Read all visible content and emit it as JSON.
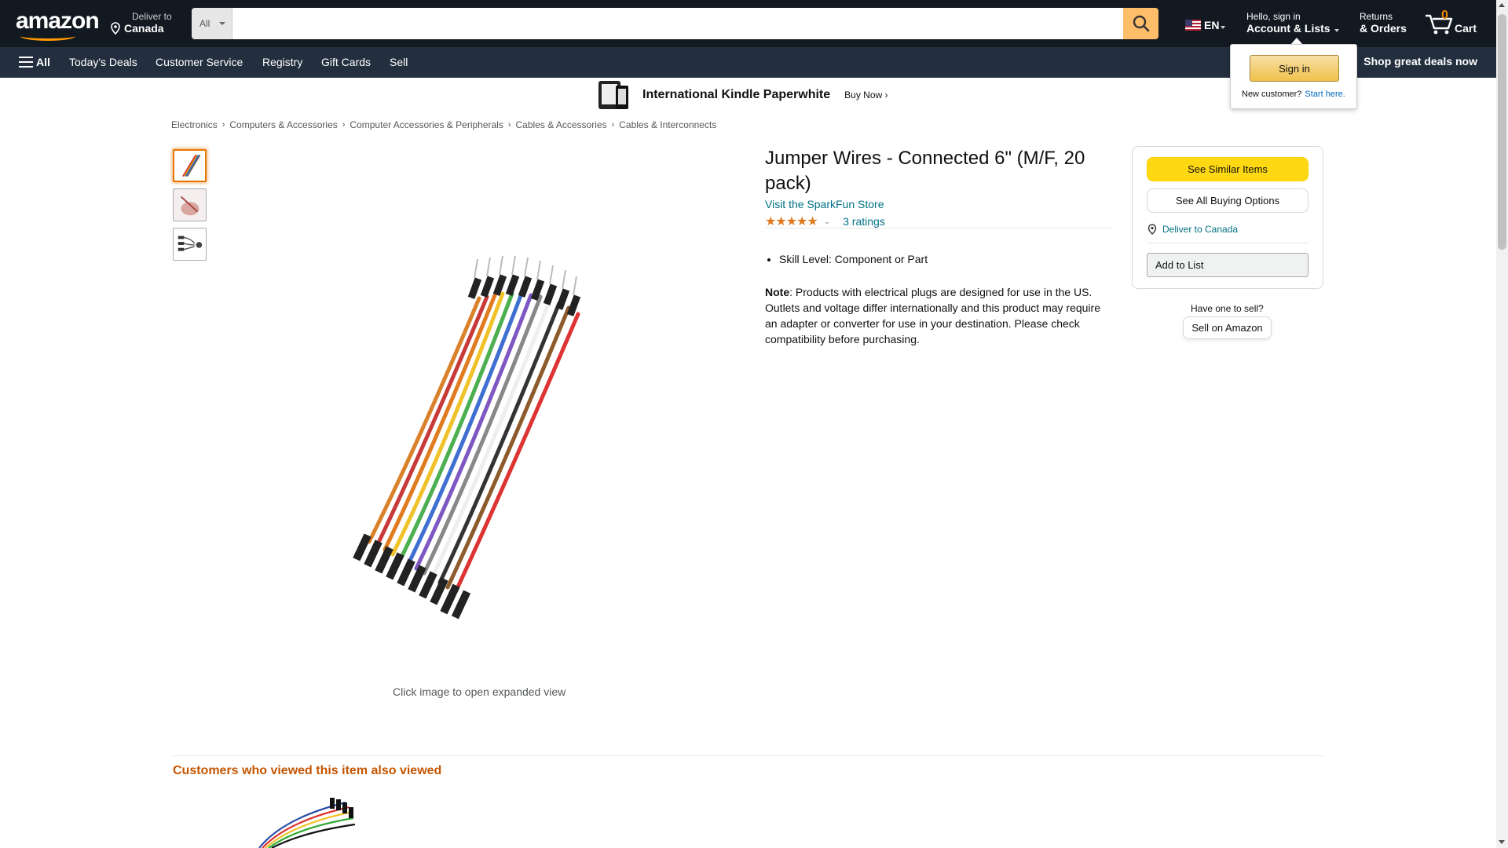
{
  "header": {
    "logo_text": "amazon",
    "deliver_line1": "Deliver to",
    "deliver_line2": "Canada",
    "search_category": "All",
    "search_placeholder": "",
    "lang": "EN",
    "account_line1": "Hello, sign in",
    "account_line2": "Account & Lists",
    "returns_line1": "Returns",
    "returns_line2": "& Orders",
    "cart_count": "0",
    "cart_label": "Cart"
  },
  "subnav": {
    "all_label": "All",
    "items": [
      "Today's Deals",
      "Customer Service",
      "Registry",
      "Gift Cards",
      "Sell"
    ],
    "promo": "Shop great deals now"
  },
  "banner": {
    "title": "International Kindle Paperwhite",
    "cta": "Buy Now ›"
  },
  "breadcrumb": [
    "Electronics",
    "Computers & Accessories",
    "Computer Accessories & Peripherals",
    "Cables & Accessories",
    "Cables & Interconnects"
  ],
  "product": {
    "title": "Jumper Wires - Connected 6\" (M/F, 20 pack)",
    "store_link": "Visit the SparkFun Store",
    "stars": "★★★★★",
    "rating_value": 5,
    "ratings_link": "3 ratings",
    "bullets": [
      "Skill Level: Component or Part"
    ],
    "note_label": "Note",
    "note_text": ": Products with electrical plugs are designed for use in the US. Outlets and voltage differ internationally and this product may require an adapter or converter for use in your destination. Please check compatibility before purchasing.",
    "image_caption": "Click image to open expanded view"
  },
  "buybox": {
    "similar": "See Similar Items",
    "buying_options": "See All Buying Options",
    "deliver_to": "Deliver to Canada",
    "add_to_list": "Add to List"
  },
  "sell": {
    "question": "Have one to sell?",
    "button": "Sell on Amazon"
  },
  "flyout": {
    "sign_in": "Sign in",
    "new_customer": "New customer?",
    "start_here": "Start here."
  },
  "section": {
    "title": "Customers who viewed this item also viewed"
  },
  "colors": {
    "nav_dark": "#131921",
    "nav_sub": "#232f3e",
    "accent_orange": "#ff9900",
    "search_button": "#febd69",
    "link": "#007185",
    "star": "#de7921",
    "buy_yellow": "#ffd814",
    "section_title": "#c45500"
  }
}
